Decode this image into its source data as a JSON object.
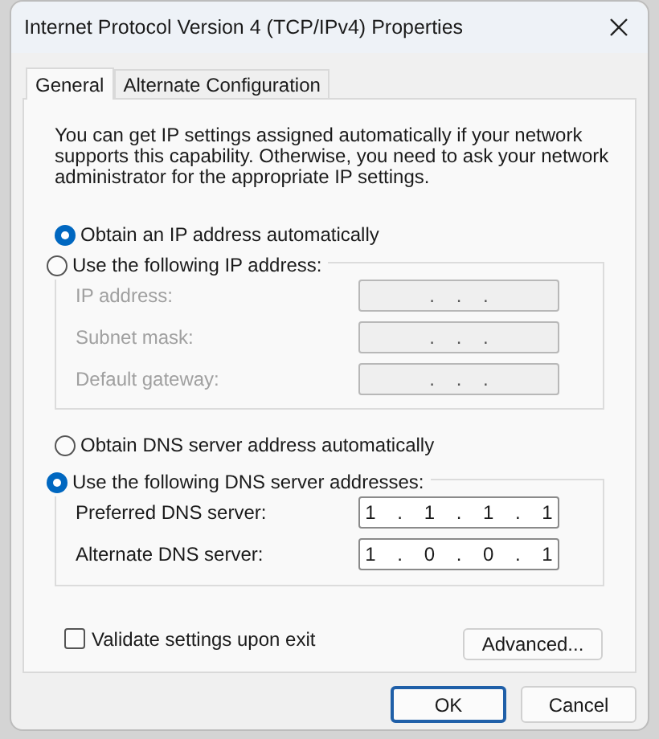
{
  "window": {
    "title": "Internet Protocol Version 4 (TCP/IPv4) Properties"
  },
  "tabs": [
    {
      "label": "General",
      "selected": true
    },
    {
      "label": "Alternate Configuration",
      "selected": false
    }
  ],
  "description": "You can get IP settings assigned automatically if your network supports this capability. Otherwise, you need to ask your network administrator for the appropriate IP settings.",
  "ip_options": [
    {
      "label": "Obtain an IP address automatically",
      "selected": true
    },
    {
      "label": "Use the following IP address:",
      "selected": false
    }
  ],
  "ip_fields": [
    {
      "label": "IP address:",
      "value": ". . .",
      "disabled": true
    },
    {
      "label": "Subnet mask:",
      "value": ". . .",
      "disabled": true
    },
    {
      "label": "Default gateway:",
      "value": ". . .",
      "disabled": true
    }
  ],
  "dns_options": [
    {
      "label": "Obtain DNS server address automatically",
      "selected": false
    },
    {
      "label": "Use the following DNS server addresses:",
      "selected": true
    }
  ],
  "dns_fields": [
    {
      "label": "Preferred DNS server:",
      "value": "1 . 1 . 1 . 1",
      "disabled": false
    },
    {
      "label": "Alternate DNS server:",
      "value": "1 . 0 . 0 . 1",
      "disabled": false
    }
  ],
  "validate": {
    "label": "Validate settings upon exit",
    "checked": false
  },
  "advanced_button": "Advanced...",
  "buttons": [
    {
      "label": "OK",
      "default": true
    },
    {
      "label": "Cancel",
      "default": false
    }
  ]
}
